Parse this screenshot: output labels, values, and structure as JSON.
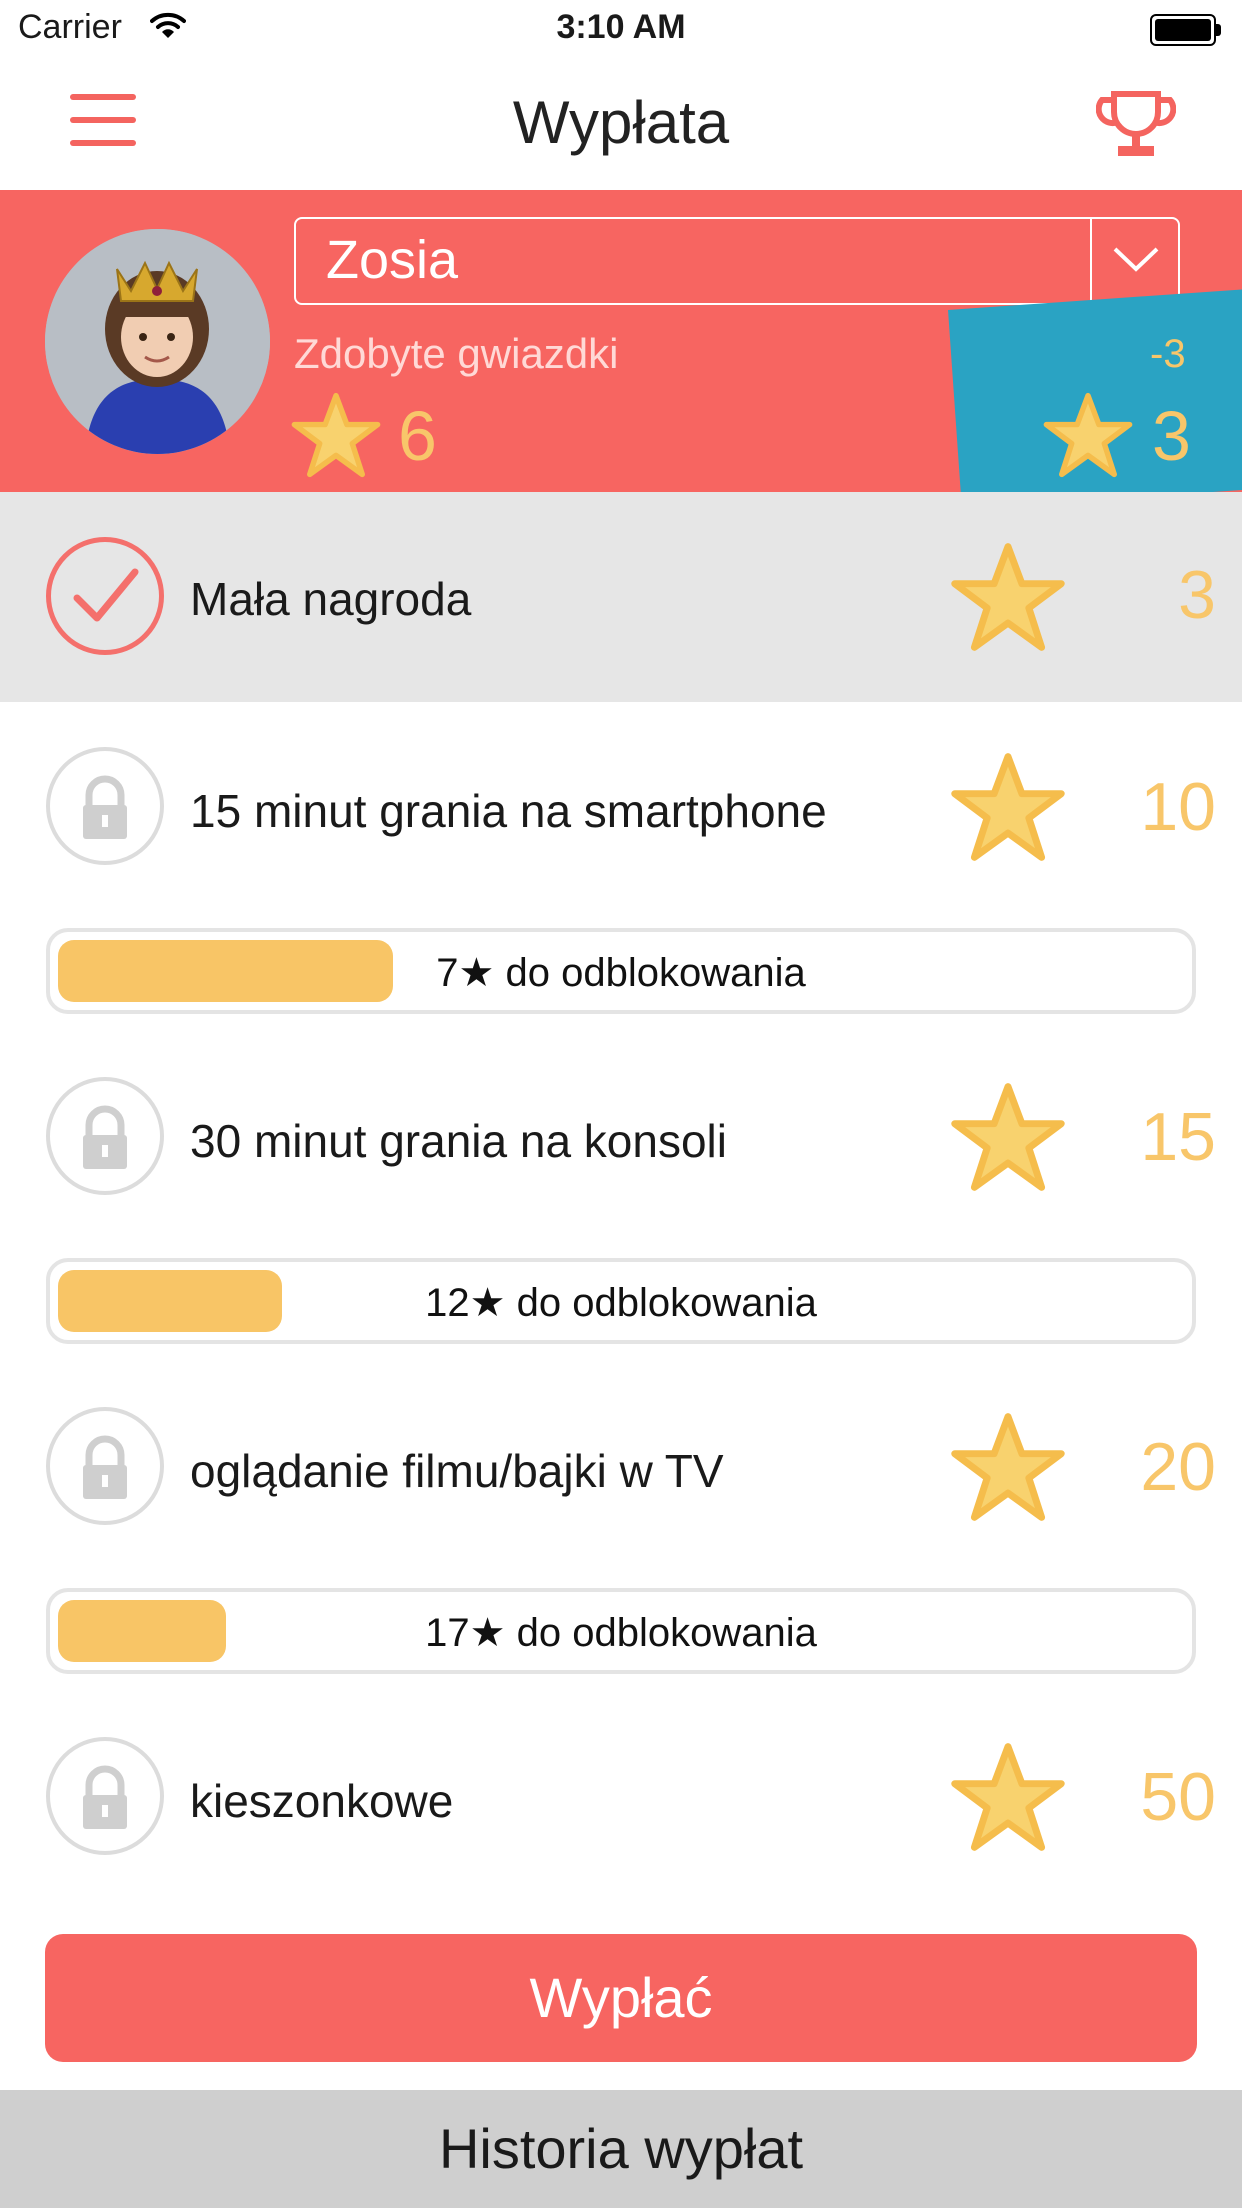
{
  "status_bar": {
    "carrier": "Carrier",
    "time": "3:10 AM"
  },
  "nav": {
    "title": "Wypłata"
  },
  "child": {
    "name": "Zosia",
    "earned_label": "Zdobyte gwiazdki",
    "earned_stars": "6",
    "diff": "-3",
    "remaining_stars": "3"
  },
  "rewards": [
    {
      "label": "Mała nagroda",
      "cost": "3",
      "status": "selected"
    },
    {
      "label": "15 minut grania na smartphone",
      "cost": "10",
      "status": "locked",
      "progress_text": "7★ do odblokowania",
      "progress_fraction": 0.3
    },
    {
      "label": "30 minut grania na konsoli",
      "cost": "15",
      "status": "locked",
      "progress_text": "12★ do odblokowania",
      "progress_fraction": 0.2
    },
    {
      "label": "oglądanie filmu/bajki w TV",
      "cost": "20",
      "status": "locked",
      "progress_text": "17★ do odblokowania",
      "progress_fraction": 0.15
    },
    {
      "label": "kieszonkowe",
      "cost": "50",
      "status": "locked"
    }
  ],
  "actions": {
    "payout": "Wypłać",
    "history": "Historia wypłat"
  },
  "colors": {
    "accent": "#f76561",
    "star": "#f8c66a",
    "card": "#2aa3c3",
    "selected_row": "#e6e6e6"
  }
}
